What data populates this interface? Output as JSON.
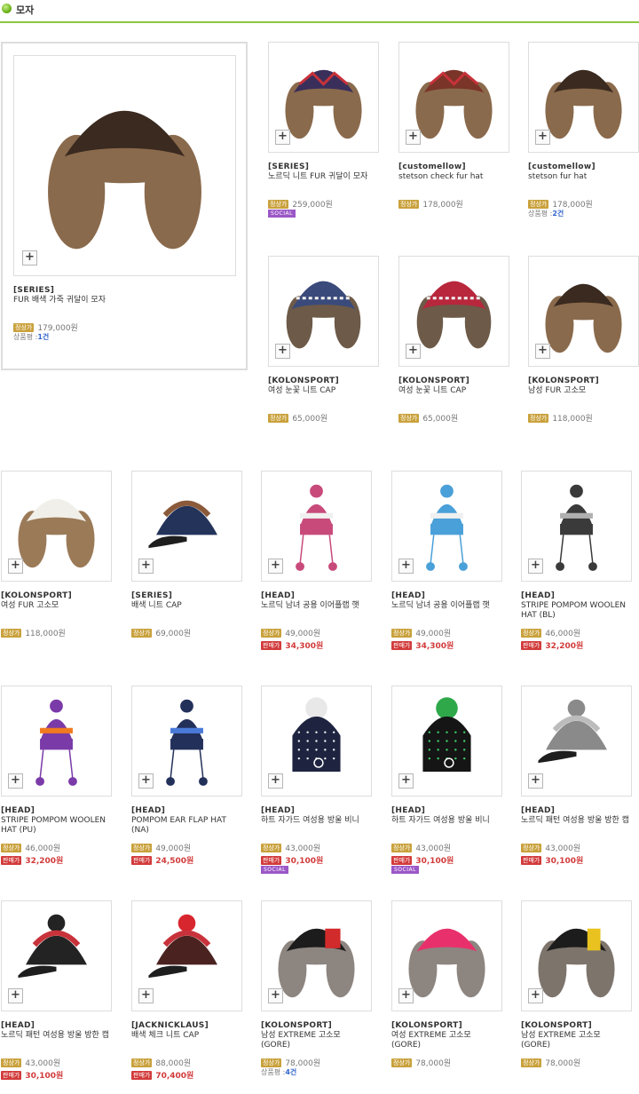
{
  "category": {
    "title": "모자"
  },
  "labels": {
    "normal": "정상가",
    "sale": "판매가",
    "social": "SOCIAL",
    "review": "상품평 :"
  },
  "products": [
    {
      "brand": "[SERIES]",
      "name": "FUR 배색 가죽 귀달이 모자",
      "price": "179,000원",
      "reviews": "1건",
      "icon": "leather-fur-trapper-hat"
    },
    {
      "brand": "[SERIES]",
      "name": "노르딕 니트 FUR 귀달이 모자",
      "price": "259,000원",
      "social": true,
      "icon": "nordic-knit-fur-hat"
    },
    {
      "brand": "[customellow]",
      "name": "stetson check fur hat",
      "price": "178,000원",
      "icon": "check-fur-hat"
    },
    {
      "brand": "[customellow]",
      "name": "stetson fur hat",
      "price": "178,000원",
      "reviews": "2건",
      "icon": "fur-hat"
    },
    {
      "brand": "[KOLONSPORT]",
      "name": "여성 눈꽃 니트 CAP",
      "price": "65,000원",
      "icon": "snowflake-knit-cap"
    },
    {
      "brand": "[KOLONSPORT]",
      "name": "여성 눈꽃 니트 CAP",
      "price": "65,000원",
      "icon": "snowflake-knit-cap-red"
    },
    {
      "brand": "[KOLONSPORT]",
      "name": "남성 FUR 고소모",
      "price": "118,000원",
      "icon": "mens-fur-hat"
    },
    {
      "brand": "[KOLONSPORT]",
      "name": "여성 FUR 고소모",
      "price": "118,000원",
      "icon": "womens-fur-hat"
    },
    {
      "brand": "[SERIES]",
      "name": "배색 니트 CAP",
      "price": "69,000원",
      "icon": "colorblock-knit-cap"
    },
    {
      "brand": "[HEAD]",
      "name": "노르딕 남녀 공용 이어플랩 햇",
      "price": "49,000원",
      "sale": "34,300원",
      "icon": "nordic-earflap-hat-pink"
    },
    {
      "brand": "[HEAD]",
      "name": "노르딕 남녀 공용 이어플랩 햇",
      "price": "49,000원",
      "sale": "34,300원",
      "icon": "nordic-earflap-hat-blue"
    },
    {
      "brand": "[HEAD]",
      "name": "STRIPE POMPOM WOOLEN HAT (BL)",
      "price": "46,000원",
      "sale": "32,200원",
      "icon": "stripe-pompom-hat-black"
    },
    {
      "brand": "[HEAD]",
      "name": "STRIPE POMPOM WOOLEN HAT (PU)",
      "price": "46,000원",
      "sale": "32,200원",
      "icon": "stripe-pompom-hat-purple"
    },
    {
      "brand": "[HEAD]",
      "name": "POMPOM EAR FLAP HAT (NA)",
      "price": "49,000원",
      "sale": "24,500원",
      "icon": "pompom-earflap-hat-navy"
    },
    {
      "brand": "[HEAD]",
      "name": "하트 자가드 여성용 방울 비니",
      "price": "43,000원",
      "sale": "30,100원",
      "social": true,
      "icon": "heart-jacquard-beanie-navy"
    },
    {
      "brand": "[HEAD]",
      "name": "하트 자가드 여성용 방울 비니",
      "price": "43,000원",
      "sale": "30,100원",
      "social": true,
      "icon": "heart-jacquard-beanie-black"
    },
    {
      "brand": "[HEAD]",
      "name": "노르딕 패턴 여성용 방울 방한 캡",
      "price": "43,000원",
      "sale": "30,100원",
      "icon": "nordic-pompom-cap-gray"
    },
    {
      "brand": "[HEAD]",
      "name": "노르딕 패턴 여성용 방울 방한 캡",
      "price": "43,000원",
      "sale": "30,100원",
      "icon": "nordic-pompom-cap-black"
    },
    {
      "brand": "[JACKNICKLAUS]",
      "name": "배색 체크 니트 CAP",
      "price": "88,000원",
      "sale": "70,400원",
      "icon": "check-knit-cap"
    },
    {
      "brand": "[KOLONSPORT]",
      "name": "남성 EXTREME 고소모 (GORE)",
      "price": "78,000원",
      "reviews": "4건",
      "icon": "extreme-trapper-red"
    },
    {
      "brand": "[KOLONSPORT]",
      "name": "여성 EXTREME 고소모 (GORE)",
      "price": "78,000원",
      "icon": "extreme-trapper-pink"
    },
    {
      "brand": "[KOLONSPORT]",
      "name": "남성 EXTREME 고소모 (GORE)",
      "price": "78,000원",
      "icon": "extreme-trapper-yellow"
    }
  ],
  "colors": {
    "accent_line": "#8cc63f",
    "sale": "#d23b3b",
    "normal_tag": "#c9a13c",
    "social": "#9b57c7"
  }
}
